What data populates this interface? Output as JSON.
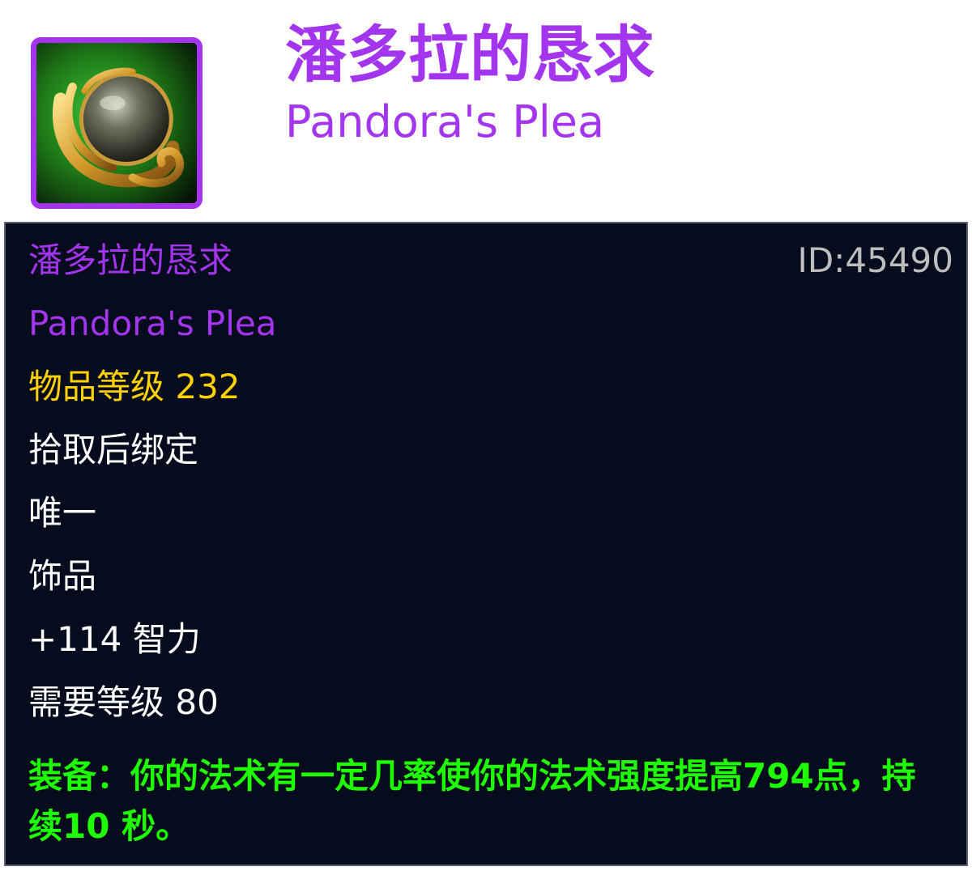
{
  "header": {
    "icon": "pandoras-plea-orb-icon",
    "title_cn": "潘多拉的恳求",
    "title_en": "Pandora's Plea"
  },
  "tooltip": {
    "name_cn": "潘多拉的恳求",
    "id_text": "ID:45490",
    "name_en": "Pandora's Plea",
    "item_level": "物品等级 232",
    "binding": "拾取后绑定",
    "unique": "唯一",
    "slot": "饰品",
    "stat": "+114 智力",
    "required_level": "需要等级 80",
    "equip_effect": "装备：你的法术有一定几率使你的法术强度提高794点，持续10 秒。"
  },
  "colors": {
    "epic": "#a335ee",
    "item_level": "#ffd100",
    "text": "#ffffff",
    "effect": "#1eff00",
    "id": "#bdbdbd",
    "tooltip_bg": "#070b1e"
  }
}
